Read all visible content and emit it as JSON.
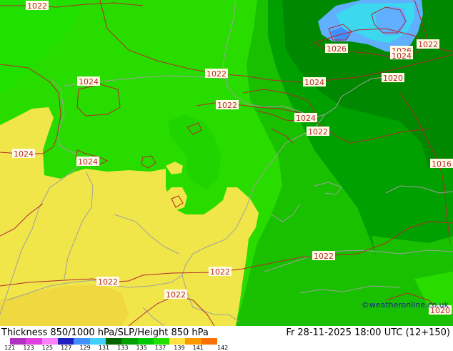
{
  "map": {
    "title": "Thickness 850/1000 hPa/SLP/Height 850 hPa",
    "valid_time": "Fr 28-11-2025 18:00 UTC (12+150)",
    "credit": "©weatheronline.co.uk",
    "isobar_labels": [
      "1022",
      "1024",
      "1022",
      "1022",
      "1024",
      "1024",
      "1022",
      "1026",
      "1026",
      "1024",
      "1022",
      "1020",
      "1016",
      "1022",
      "1022",
      "1022",
      "1022",
      "1020",
      "1024"
    ],
    "legend": {
      "ticks": [
        "121",
        "123",
        "125",
        "127",
        "129",
        "131",
        "133",
        "135",
        "137",
        "139",
        "141",
        "142"
      ],
      "colors": [
        "#b030c0",
        "#e040e0",
        "#ff80ff",
        "#2020c0",
        "#4090ff",
        "#40d0ff",
        "#006400",
        "#00a000",
        "#00c800",
        "#20e000",
        "#ffe040",
        "#ff9900",
        "#ff7000"
      ]
    },
    "colors": {
      "isobar": "#b4282d",
      "coast": "#a0a0a0",
      "yellow": "#f0e64a",
      "bright_green": "#28dc00",
      "mid_green": "#18c000",
      "dark_green": "#00a000",
      "darker_green": "#008800",
      "cyan": "#3cd8f0",
      "light_blue": "#60b0ff"
    }
  }
}
